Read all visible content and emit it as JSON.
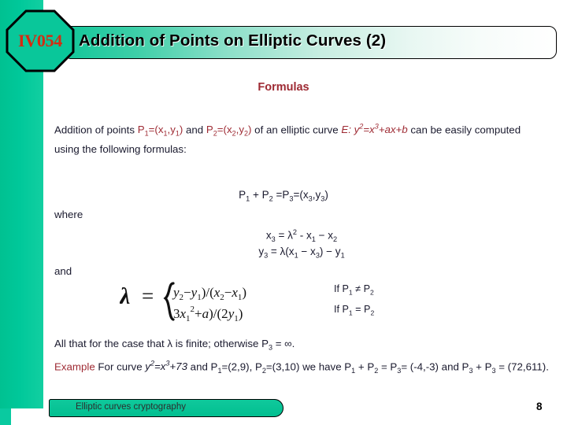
{
  "badge": {
    "label": "IV054",
    "fill_color": "#00c89a",
    "text_color": "#d42b11"
  },
  "title_bar": {
    "title": "Addition of Points on Elliptic Curves (2)",
    "gradient_start": "#14c79a",
    "gradient_end": "#ffffff"
  },
  "content": {
    "heading": "Formulas",
    "accent_color": "#9e2a33",
    "paragraph": {
      "part1": "Addition of points ",
      "p1": "P",
      "p1_sub": "1",
      "p1_eq": "=(x",
      "p1_x_sub": "1",
      "p1_mid": ",y",
      "p1_y_sub": "1",
      "p1_end": ")",
      "part2": " and ",
      "p2": "P",
      "p2_sub": "2",
      "p2_eq": "=(x",
      "p2_x_sub": "2",
      "p2_mid": ",y",
      "p2_y_sub": "2",
      "p2_end": ")",
      "part3": " of an elliptic curve ",
      "curve_label": "E",
      "curve_colon": ": ",
      "curve_y": "y",
      "curve_y_sup": "2",
      "curve_eq": "=x",
      "curve_x_sup": "3",
      "curve_rest": "+ax+b",
      "part4": " can be easily computed using the following formulas:"
    },
    "eq_main": {
      "p1": "P",
      "p1_sub": "1",
      "plus": " + ",
      "p2": "P",
      "p2_sub": "2",
      "eq": " =",
      "p3": "P",
      "p3_sub": "3",
      "eq2": "=(x",
      "x3_sub": "3",
      "comma": ",y",
      "y3_sub": "3",
      "close": ")"
    },
    "label_where": "where",
    "label_and": "and",
    "eq_x3": {
      "lhs": "x",
      "lhs_sub": "3",
      "op": " = λ",
      "sup": "2",
      "mid": " - x",
      "s1": "1",
      "minus": " − x",
      "s2": "2"
    },
    "eq_y3": {
      "lhs": "y",
      "lhs_sub": "3",
      "op": " = λ(x",
      "s1": "1",
      "minus": " − x",
      "s2": "3",
      "close": ") − y",
      "s3": "1"
    },
    "lambda_formula": {
      "lambda": "λ",
      "equals": "=",
      "case1_num_y2": "y",
      "case1_num_y2_sub": "2",
      "case1_minus": "−",
      "case1_num_y1": "y",
      "case1_num_y1_sub": "1",
      "case1_div": ")/(",
      "case1_den_x2": "x",
      "case1_den_x2_sub": "2",
      "case1_den_x1": "x",
      "case1_den_x1_sub": "1",
      "case1_close": ")",
      "case2_three": "3",
      "case2_x": "x",
      "case2_x_sub": "1",
      "case2_x_sup": "2",
      "case2_plus_a": "+a",
      "case2_div": ")/(",
      "case2_two": "2",
      "case2_y": "y",
      "case2_y_sub": "1",
      "case2_close": ")"
    },
    "condition_1": {
      "prefix": "If P",
      "sub1": "1",
      "op": " ≠ P",
      "sub2": "2"
    },
    "condition_2": {
      "prefix": "If P",
      "sub1": "1",
      "op": " = P",
      "sub2": "2"
    },
    "bottom_line_1": {
      "text_a": "All that for the case that λ is finite; otherwise P",
      "sub": "3",
      "text_b": " = ∞."
    },
    "bottom_line_2": {
      "example_label": "Example",
      "text_a": " For curve ",
      "curve_y": "y",
      "curve_y_sup": "2",
      "curve_eq": "=x",
      "curve_x_sup": "3",
      "curve_const": "+73",
      "text_b": " and P",
      "s1": "1",
      "text_c": "=(2,9), P",
      "s2": "2",
      "text_d": "=(3,10) we have P",
      "s3": "1",
      "text_e": " + P",
      "s4": "2",
      "text_f": " = P",
      "s5": "3",
      "text_g": "= (-4,-3) and P",
      "s6": "3",
      "text_h": " + P",
      "s7": "3",
      "text_i": " = (72,611)."
    }
  },
  "footer": {
    "label": "Elliptic curves cryptography",
    "page_number": "8",
    "pill_color": "#02bf90"
  }
}
